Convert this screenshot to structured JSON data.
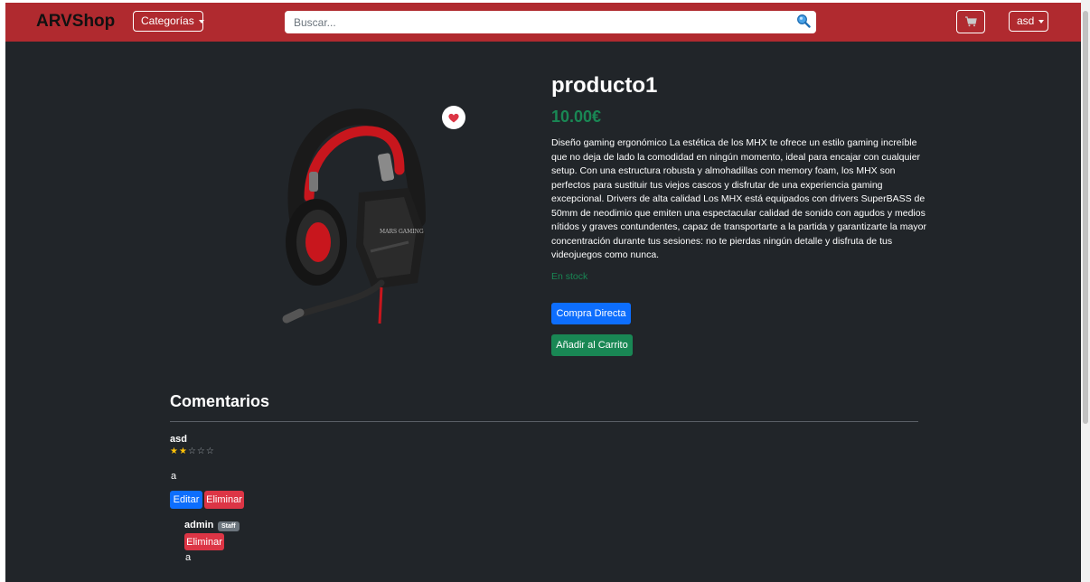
{
  "navbar": {
    "brand": "ARVShop",
    "categories_label": "Categorías",
    "search_placeholder": "Buscar...",
    "user_label": "asd"
  },
  "product": {
    "title": "producto1",
    "price": "10.00€",
    "description": "Diseño gaming ergonómico La estética de los MHX te ofrece un estilo gaming increíble que no deja de lado la comodidad en ningún momento, ideal para encajar con cualquier setup. Con una estructura robusta y almohadillas con memory foam, los MHX son perfectos para sustituir tus viejos cascos y disfrutar de una experiencia gaming excepcional. Drivers de alta calidad Los MHX está equipados con drivers SuperBASS de 50mm de neodimio que emiten una espectacular calidad de sonido con agudos y medios nítidos y graves contundentes, capaz de transportarte a la partida y garantizarte la mayor concentración durante tus sesiones: no te pierdas ningún detalle y disfruta de tus videojuegos como nunca.",
    "stock": "En stock",
    "buy_label": "Compra Directa",
    "add_cart_label": "Añadir al Carrito",
    "image_brand_text": "MARS GAMING"
  },
  "comments": {
    "title": "Comentarios",
    "items": [
      {
        "author": "asd",
        "rating": 2,
        "rating_max": 5,
        "text": "a",
        "edit_label": "Editar",
        "delete_label": "Eliminar",
        "replies": [
          {
            "author": "admin",
            "badge": "Staff",
            "delete_label": "Eliminar",
            "text": "a"
          }
        ]
      }
    ]
  },
  "colors": {
    "navbar": "#b02a2f",
    "background": "#212529",
    "price": "#198754",
    "primary": "#0d6efd",
    "danger": "#dc3545",
    "star": "#ffc107"
  }
}
